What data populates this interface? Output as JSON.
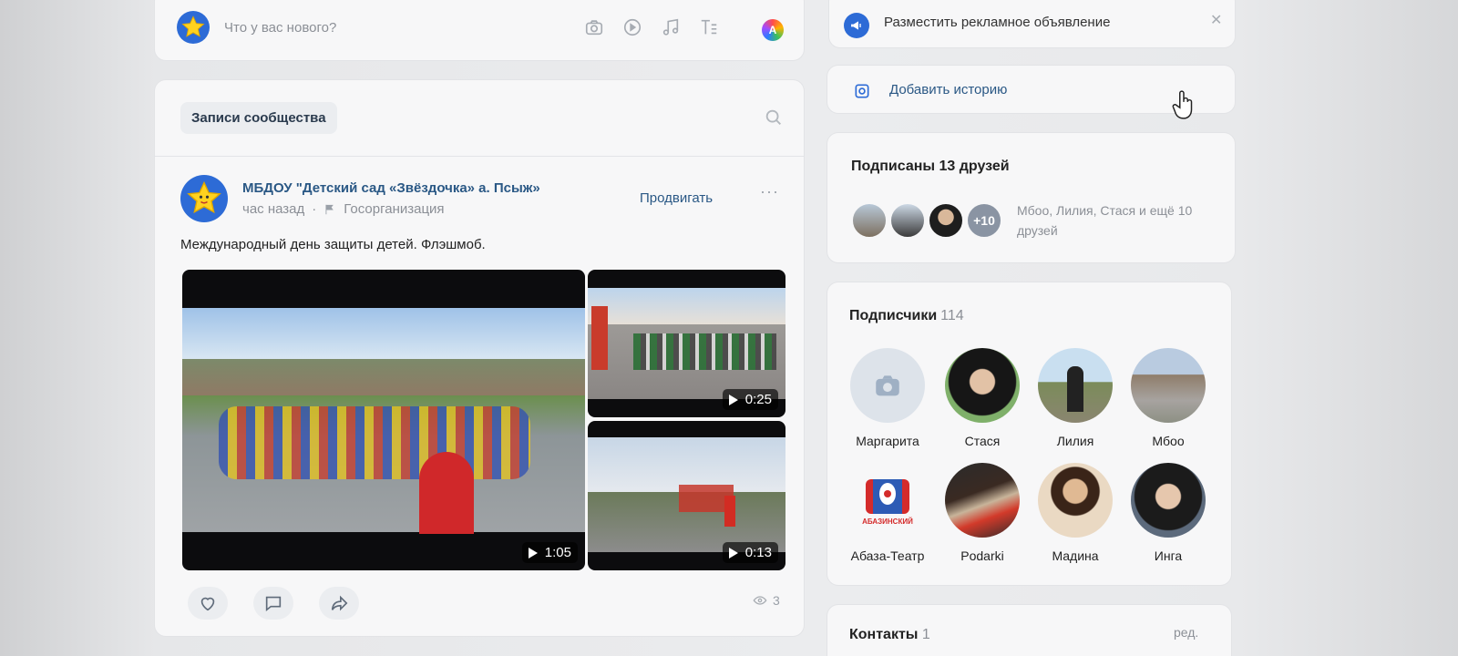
{
  "composer": {
    "placeholder": "Что у вас нового?",
    "tools": [
      "photo-icon",
      "video-icon",
      "music-icon",
      "article-icon"
    ],
    "app_icon_letter": "A"
  },
  "feed": {
    "tab_label": "Записи сообщества",
    "post": {
      "author": "МБДОУ \"Детский сад «Звёздочка» а. Псыж»",
      "time": "час назад",
      "category": "Госорганизация",
      "promote_label": "Продвигать",
      "more_label": "···",
      "text": "Международный день защиты детей. Флэшмоб.",
      "videos": [
        {
          "duration": "1:05"
        },
        {
          "duration": "0:25"
        },
        {
          "duration": "0:13"
        }
      ],
      "views": "3"
    }
  },
  "right": {
    "ad_label": "Разместить рекламное объявление",
    "ad_close": "✕",
    "story_label": "Добавить историю",
    "friends_title": "Подписаны 13 друзей",
    "friends_more": "+10",
    "friends_names": "Мбоо, Лилия, Стася и ещё 10 друзей",
    "subscribers_title": "Подписчики",
    "subscribers_count": "114",
    "subscribers": [
      {
        "name": "Маргарита"
      },
      {
        "name": "Стася"
      },
      {
        "name": "Лилия"
      },
      {
        "name": "Мбоо"
      },
      {
        "name": "Абаза-Театр",
        "logo_text": "АБАЗИНСКИЙ"
      },
      {
        "name": "Podarki"
      },
      {
        "name": "Мадина"
      },
      {
        "name": "Инга"
      }
    ],
    "contacts_title": "Контакты",
    "contacts_count": "1",
    "contacts_edit": "ред."
  },
  "colors": {
    "link": "#2a5885",
    "accent": "#2d6bd6",
    "muted": "#8b8f96"
  }
}
